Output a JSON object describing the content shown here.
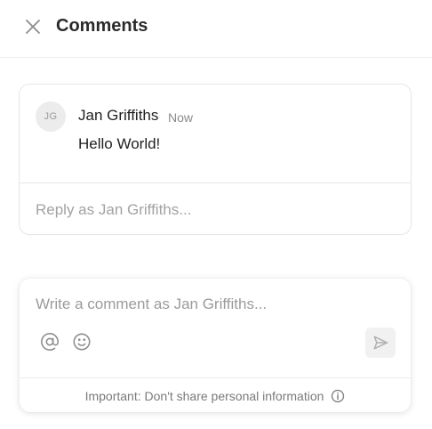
{
  "header": {
    "title": "Comments",
    "close_icon": "close-icon"
  },
  "thread": {
    "author": {
      "initials": "JG",
      "name": "Jan Griffiths"
    },
    "timestamp": "Now",
    "body": "Hello World!",
    "reply_placeholder": "Reply as Jan Griffiths..."
  },
  "composer": {
    "placeholder": "Write a comment as Jan Griffiths...",
    "value": "",
    "tools": [
      "at-sign-icon",
      "emoji-icon"
    ],
    "send_icon": "send-icon",
    "disclaimer": "Important: Don't share personal information",
    "disclaimer_icon": "info-icon"
  },
  "colors": {
    "icon_gray": "#8c8c8c",
    "placeholder_gray": "#a2a2a2",
    "border": "#e6e6e6",
    "avatar_bg": "#ececec",
    "send_bg": "#f1f1f1"
  }
}
